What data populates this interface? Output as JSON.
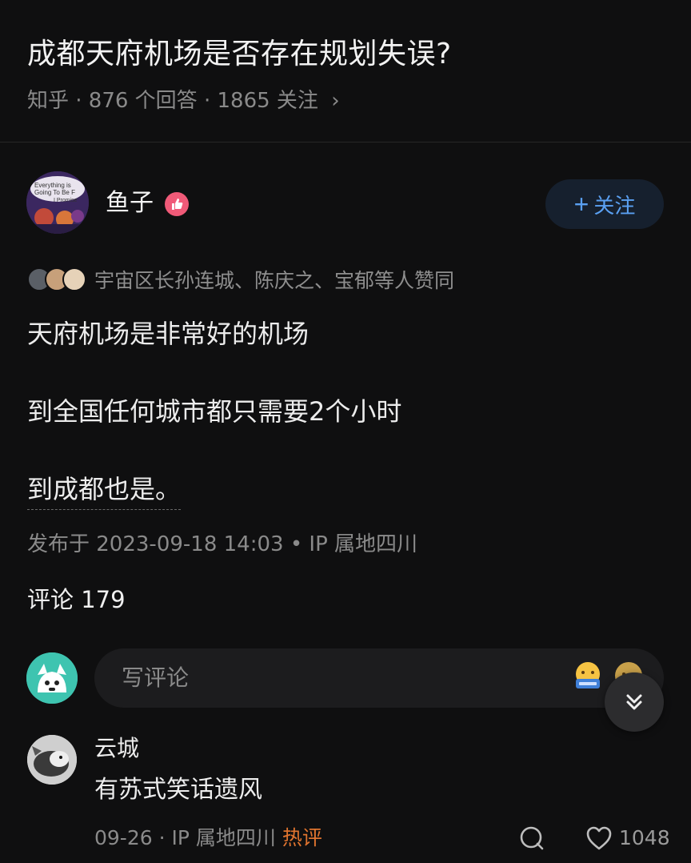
{
  "question": {
    "title": "成都天府机场是否存在规划失误?",
    "meta": "知乎 · 876 个回答 · 1865 关注"
  },
  "author": {
    "name": "鱼子",
    "badge_icon": "thumbs-up-badge-icon",
    "follow_label": "关注"
  },
  "voters": {
    "text": "宇宙区长孙连城、陈庆之、宝郁等人赞同"
  },
  "answer": {
    "paragraphs": [
      "天府机场是非常好的机场",
      "到全国任何城市都只需要2个小时",
      "到成都也是。"
    ],
    "published": "发布于 2023-09-18 14:03 • IP 属地四川"
  },
  "comments": {
    "count_label": "评论 179",
    "input_placeholder": "写评论",
    "items": [
      {
        "author": "云城",
        "text": "有苏式笑话遗风",
        "date": "09-26",
        "ip": "IP 属地四川",
        "tag": "热评",
        "likes": "1048"
      }
    ]
  },
  "colors": {
    "background": "#0f0f10",
    "accent_blue": "#5aa0f2",
    "hot_orange": "#e0742f",
    "badge_pink": "#f05a78"
  }
}
